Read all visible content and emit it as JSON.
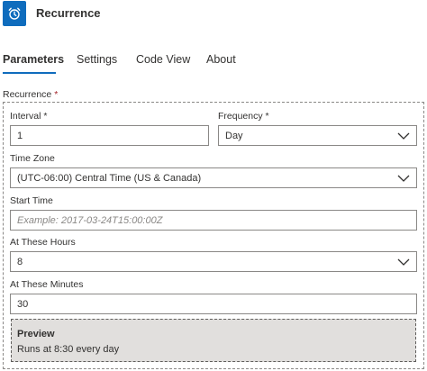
{
  "header": {
    "title": "Recurrence",
    "icon": "alarm-clock-icon",
    "accent": "#0f6cbd"
  },
  "tabs": [
    {
      "label": "Parameters",
      "active": true
    },
    {
      "label": "Settings",
      "active": false
    },
    {
      "label": "Code View",
      "active": false
    },
    {
      "label": "About",
      "active": false
    }
  ],
  "recurrence": {
    "label": "Recurrence",
    "required_mark": "*",
    "interval": {
      "label": "Interval",
      "required_mark": "*",
      "value": "1"
    },
    "frequency": {
      "label": "Frequency",
      "required_mark": "*",
      "value": "Day"
    },
    "time_zone": {
      "label": "Time Zone",
      "value": "(UTC-06:00) Central Time (US & Canada)"
    },
    "start_time": {
      "label": "Start Time",
      "value": "",
      "placeholder": "Example: 2017-03-24T15:00:00Z"
    },
    "at_these_hours": {
      "label": "At These Hours",
      "value": "8"
    },
    "at_these_minutes": {
      "label": "At These Minutes",
      "value": "30"
    }
  },
  "preview": {
    "title": "Preview",
    "text": "Runs at 8:30 every day"
  }
}
